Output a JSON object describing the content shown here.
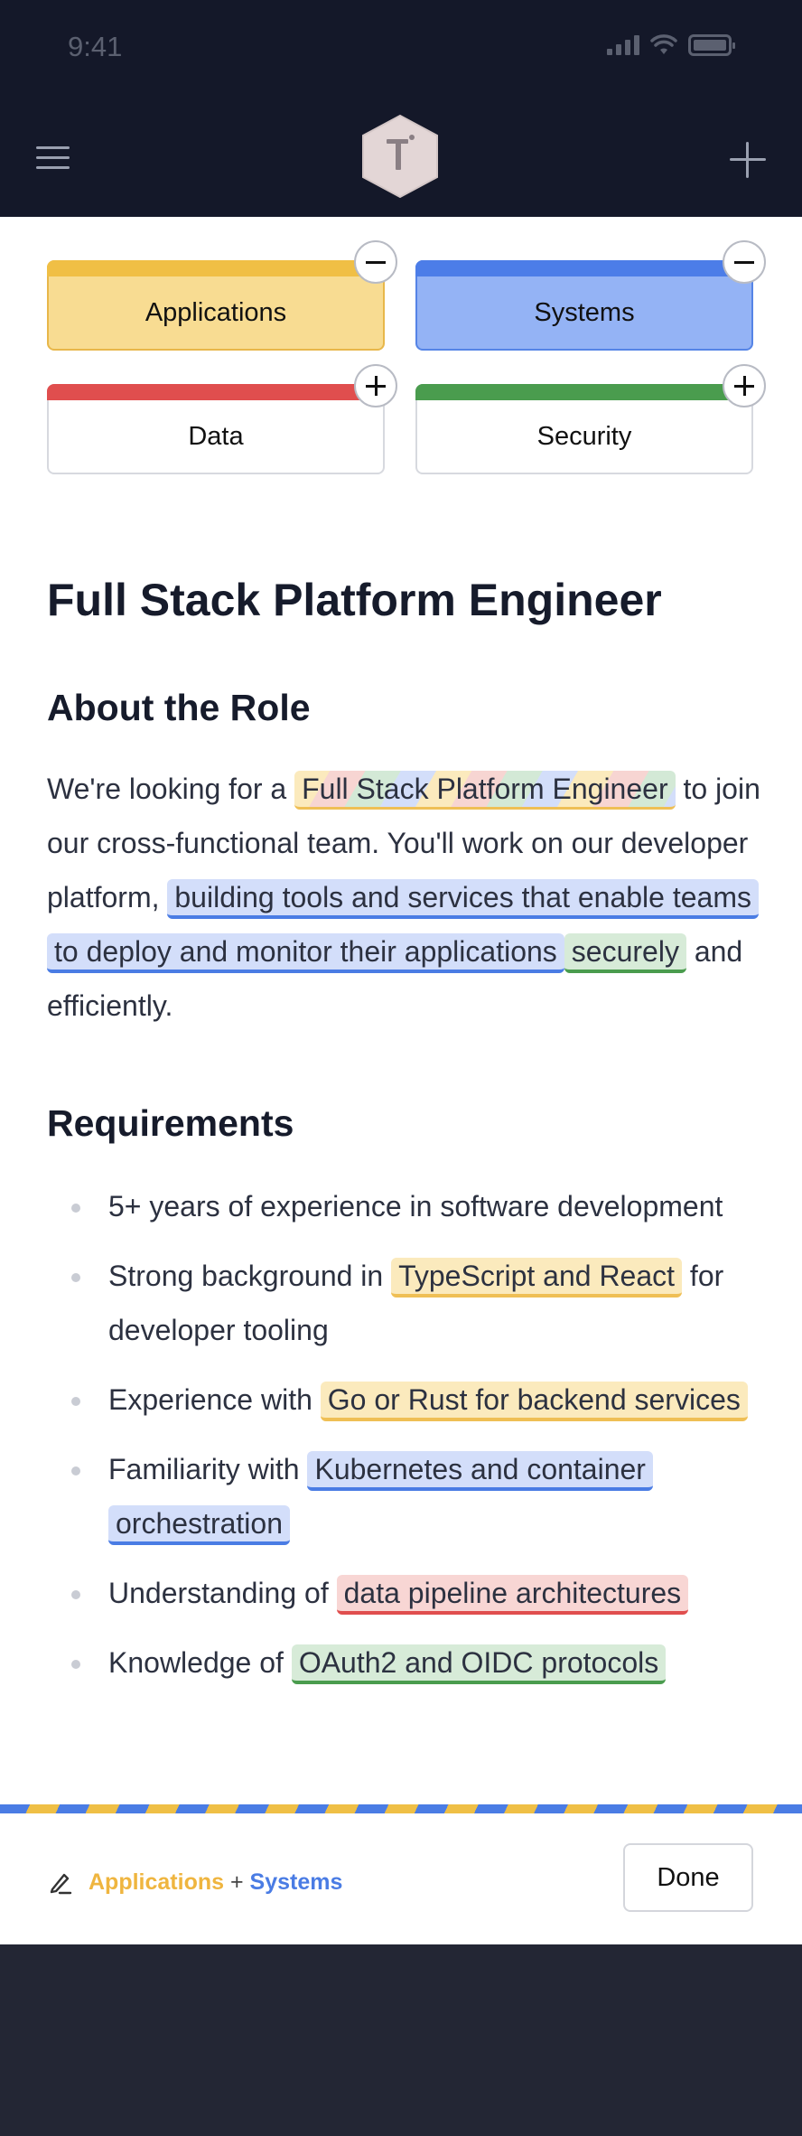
{
  "status_bar": {
    "time": "9:41"
  },
  "categories": [
    {
      "label": "Applications",
      "selected": true,
      "color": "#f0bf45"
    },
    {
      "label": "Systems",
      "selected": true,
      "color": "#4c7de8"
    },
    {
      "label": "Data",
      "selected": false,
      "color": "#e04e4e"
    },
    {
      "label": "Security",
      "selected": false,
      "color": "#4a9c4e"
    }
  ],
  "job": {
    "title": "Full Stack Platform Engineer",
    "about_heading": "About the Role",
    "about": {
      "t1": "We're looking for a ",
      "h1": "Full Stack Platform Engineer",
      "t2": " to join our cross-functional team. You'll work on our developer platform, ",
      "h2": "building tools and services that enable teams to deploy and monitor their applications",
      "h3": "securely",
      "t3": " and efficiently."
    },
    "requirements_heading": "Requirements",
    "requirements": [
      {
        "text": "5+ years of experience in software development",
        "highlight": ""
      },
      {
        "text": "Strong background in ",
        "highlight": "TypeScript and React",
        "after": " for developer tooling"
      },
      {
        "text": "Experience with ",
        "highlight": "Go or Rust for backend services",
        "after": ""
      },
      {
        "text": "Familiarity with ",
        "highlight": "Kubernetes and container orchestration",
        "after": ""
      },
      {
        "text": "Understanding of ",
        "highlight": "data pipeline architectures",
        "after": ""
      },
      {
        "text": "Knowledge of ",
        "highlight": "OAuth2 and OIDC protocols",
        "after": ""
      }
    ]
  },
  "footer": {
    "selection_a": "Applications",
    "selection_joiner": "+",
    "selection_b": "Systems",
    "done_label": "Done"
  },
  "icons": [
    "menu-icon",
    "logo-icon",
    "plus-icon",
    "pen-icon",
    "signal-icon",
    "wifi-icon",
    "battery-icon",
    "minus-icon"
  ]
}
